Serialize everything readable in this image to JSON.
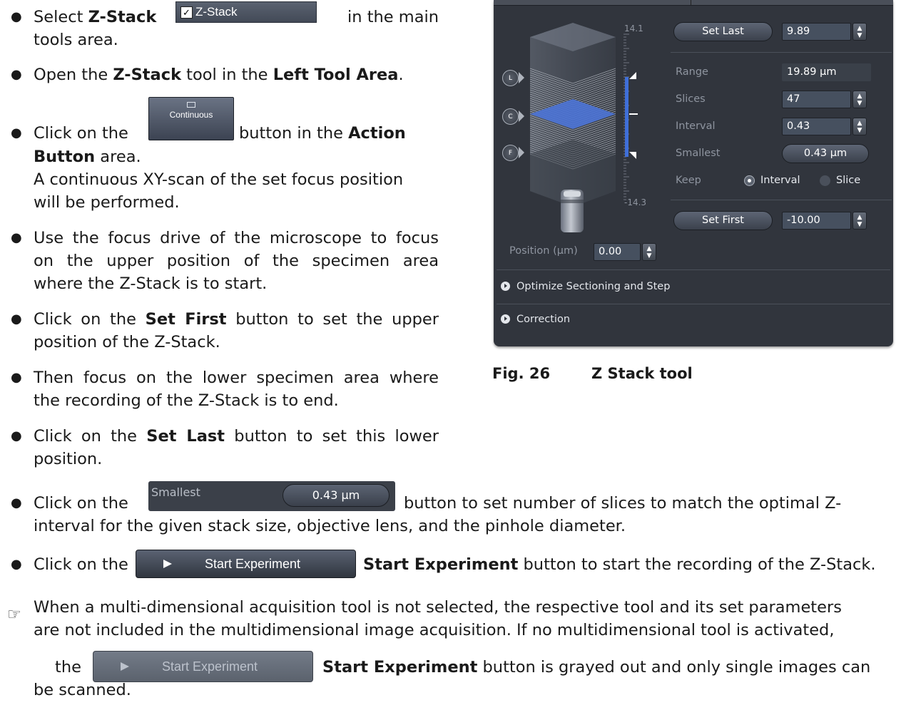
{
  "bullets": {
    "b1": {
      "pre": "Select ",
      "b": "Z-Stack",
      "post": " in the main",
      "line2": "tools area."
    },
    "b2": {
      "pre": "Open the ",
      "b1": "Z-Stack",
      "mid": " tool in the ",
      "b2": "Left Tool Area",
      "post": "."
    },
    "b3": {
      "pre": "Click on the",
      "mid": " button in the ",
      "b": "Action",
      "line2b": "Button",
      "line2": " area.",
      "line3": "A continuous XY-scan of the set focus position",
      "line4": "will be performed."
    },
    "b4": {
      "line1": "Use the focus drive of the microscope to focus",
      "line2": "on the upper position of the specimen area",
      "line3": "where the Z-Stack is to start."
    },
    "b5": {
      "pre": "Click on the ",
      "b": "Set First",
      "post": " button to set the upper",
      "line2": "position of the Z-Stack."
    },
    "b6": {
      "line1": "Then focus on the lower specimen area where",
      "line2": "the recording of the Z-Stack is to end."
    },
    "b7": {
      "pre": "Click on the ",
      "b": "Set Last",
      "post": " button to set this lower",
      "line2": "position."
    },
    "b8": {
      "pre": "Click on the",
      "post": "button to set number of slices to match the optimal Z-",
      "line2": "interval for the given stack size, objective lens, and the pinhole diameter."
    },
    "b9": {
      "pre": "Click on the",
      "b": "Start Experiment",
      "post": " button to start the recording of the Z-Stack."
    }
  },
  "note": {
    "line1": "When a multi-dimensional acquisition tool is not selected, the respective tool and its set parameters",
    "line2": "are not included in the multidimensional image acquisition. If no multidimensional tool is activated,",
    "pre": "the",
    "b": "Start Experiment",
    "post": " button is grayed out and only single images can",
    "line4": "be scanned."
  },
  "inline_ui": {
    "zstack_check": "Z-Stack",
    "continuous_btn": "Continuous",
    "smallest_label": "Smallest",
    "smallest_value": "0.43 µm",
    "start_exp": "Start Experiment",
    "start_exp_disabled": "Start Experiment"
  },
  "panel": {
    "set_last": "Set Last",
    "set_last_val": "9.89",
    "top_scale": "14.1",
    "bottom_scale": "-14.3",
    "range_lbl": "Range",
    "range_val": "19.89 µm",
    "slices_lbl": "Slices",
    "slices_val": "47",
    "interval_lbl": "Interval",
    "interval_val": "0.43",
    "smallest_lbl": "Smallest",
    "smallest_val": "0.43 µm",
    "keep_lbl": "Keep",
    "keep_interval": "Interval",
    "keep_slice": "Slice",
    "set_first": "Set First",
    "set_first_val": "-10.00",
    "position_lbl": "Position (µm)",
    "position_val": "0.00",
    "marker_L": "L",
    "marker_C": "C",
    "marker_F": "F",
    "section_optimize": "Optimize Sectioning and Step",
    "section_correction": "Correction"
  },
  "caption": {
    "num": "Fig. 26",
    "title": "Z Stack tool"
  },
  "colors": {
    "panel_bg": "#31353d",
    "accent_blue": "#3f6fd9"
  }
}
